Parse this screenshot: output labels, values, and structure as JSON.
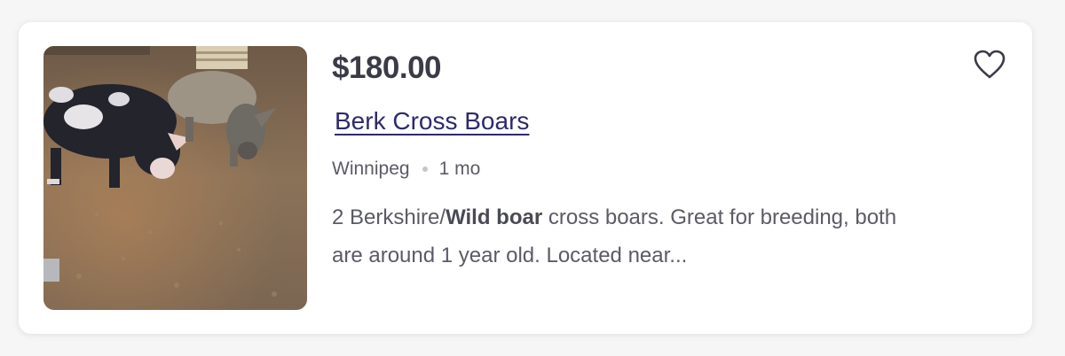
{
  "listing": {
    "price": "$180.00",
    "title": "Berk Cross Boars",
    "location": "Winnipeg",
    "age": "1 mo",
    "description": {
      "part1": "2 Berkshire/",
      "bold": "Wild boar",
      "part2": " cross boars. Great for breeding, both are around 1 year old. Located near..."
    },
    "image": {
      "subject": "two pigs in a dirt pen",
      "icon": "photo-thumbnail"
    },
    "favorite": {
      "icon": "heart-outline-icon",
      "color": "#3a3a48"
    }
  },
  "colors": {
    "title_link": "#2e2a6e",
    "price_text": "#3a3a48",
    "meta_text": "#5b5b66"
  }
}
